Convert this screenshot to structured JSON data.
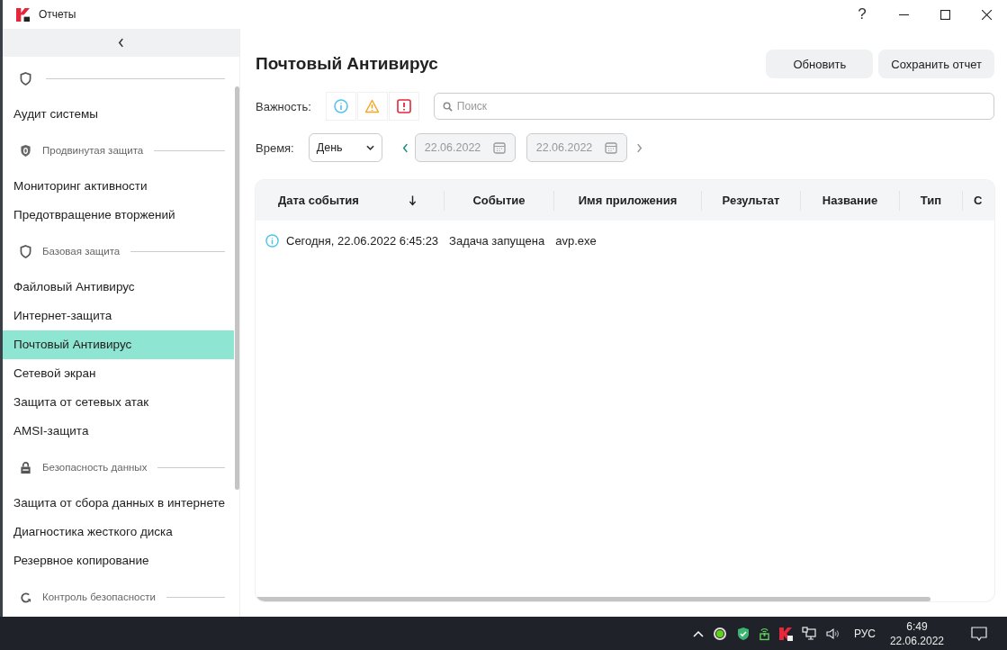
{
  "window": {
    "title": "Отчеты",
    "help": "?"
  },
  "sidebar": {
    "groups": [
      {
        "items": [
          {
            "label": "Аудит системы",
            "selected": false
          }
        ]
      },
      {
        "label": "Продвинутая защита",
        "items": [
          {
            "label": "Мониторинг активности",
            "selected": false
          },
          {
            "label": "Предотвращение вторжений",
            "selected": false
          }
        ]
      },
      {
        "label": "Базовая защита",
        "items": [
          {
            "label": "Файловый Антивирус",
            "selected": false
          },
          {
            "label": "Интернет-защита",
            "selected": false
          },
          {
            "label": "Почтовый Антивирус",
            "selected": true
          },
          {
            "label": "Сетевой экран",
            "selected": false
          },
          {
            "label": "Защита от сетевых атак",
            "selected": false
          },
          {
            "label": "AMSI-защита",
            "selected": false
          }
        ]
      },
      {
        "label": "Безопасность данных",
        "items": [
          {
            "label": "Защита от сбора данных в интернете",
            "selected": false
          },
          {
            "label": "Диагностика жесткого диска",
            "selected": false
          },
          {
            "label": "Резервное копирование",
            "selected": false
          }
        ]
      },
      {
        "label": "Контроль безопасности"
      }
    ]
  },
  "page": {
    "title": "Почтовый Антивирус",
    "buttons": [
      "Обновить",
      "Сохранить отчет"
    ],
    "severity_label": "Важность:",
    "severity_filters": [
      {
        "kind": "info"
      },
      {
        "kind": "warning"
      },
      {
        "kind": "error"
      }
    ],
    "search": {
      "placeholder": "Поиск"
    },
    "time_label": "Время:",
    "period": "День",
    "date_from": "22.06.2022",
    "date_to": "22.06.2022"
  },
  "table": {
    "columns": [
      "Дата события",
      "Событие",
      "Имя приложения",
      "Результат",
      "Название",
      "Тип",
      "С"
    ],
    "rows": [
      {
        "kind": "info",
        "cells": [
          "Сегодня, 22.06.2022 6:45:23",
          "Задача запущена",
          "avp.exe"
        ]
      }
    ]
  },
  "taskbar": {
    "language": "РУС",
    "time": "6:49",
    "date": "22.06.2022"
  }
}
